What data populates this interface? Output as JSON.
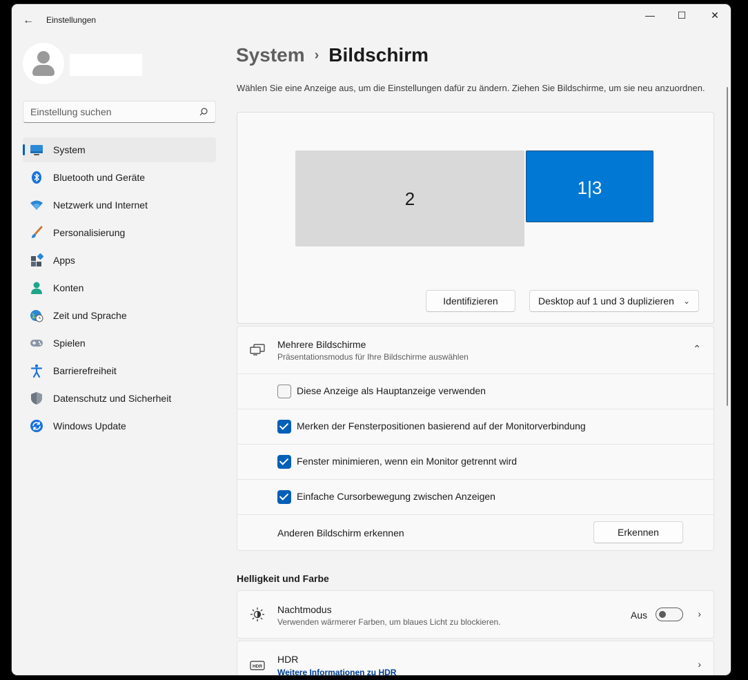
{
  "window": {
    "app_title": "Einstellungen",
    "controls": {
      "minimize": "—",
      "maximize": "☐",
      "close": "✕"
    }
  },
  "sidebar": {
    "search_placeholder": "Einstellung suchen",
    "items": [
      {
        "label": "System",
        "icon": "monitor-icon",
        "active": true
      },
      {
        "label": "Bluetooth und Geräte",
        "icon": "bluetooth-icon"
      },
      {
        "label": "Netzwerk und Internet",
        "icon": "wifi-icon"
      },
      {
        "label": "Personalisierung",
        "icon": "brush-icon"
      },
      {
        "label": "Apps",
        "icon": "apps-icon"
      },
      {
        "label": "Konten",
        "icon": "account-icon"
      },
      {
        "label": "Zeit und Sprache",
        "icon": "globe-clock-icon"
      },
      {
        "label": "Spielen",
        "icon": "gamepad-icon"
      },
      {
        "label": "Barrierefreiheit",
        "icon": "accessibility-icon"
      },
      {
        "label": "Datenschutz und Sicherheit",
        "icon": "shield-icon"
      },
      {
        "label": "Windows Update",
        "icon": "update-icon"
      }
    ]
  },
  "main": {
    "breadcrumb": {
      "parent": "System",
      "separator": "›",
      "current": "Bildschirm"
    },
    "description": "Wählen Sie eine Anzeige aus, um die Einstellungen dafür zu ändern. Ziehen Sie Bildschirme, um sie neu anzuordnen.",
    "arrangement": {
      "monitors": [
        {
          "label": "2",
          "selected": false
        },
        {
          "label": "1|3",
          "selected": true
        }
      ],
      "identify_button": "Identifizieren",
      "mode_select": "Desktop auf 1 und 3 duplizieren"
    },
    "multiple_displays": {
      "title": "Mehrere Bildschirme",
      "subtitle": "Präsentationsmodus für Ihre Bildschirme auswählen",
      "options": [
        {
          "label": "Diese Anzeige als Hauptanzeige verwenden",
          "checked": false
        },
        {
          "label": "Merken der Fensterpositionen basierend auf der Monitorverbindung",
          "checked": true
        },
        {
          "label": "Fenster minimieren, wenn ein Monitor getrennt wird",
          "checked": true
        },
        {
          "label": "Einfache Cursorbewegung zwischen Anzeigen",
          "checked": true
        }
      ],
      "detect_label": "Anderen Bildschirm erkennen",
      "detect_button": "Erkennen"
    },
    "brightness_section": {
      "heading": "Helligkeit und Farbe",
      "night_mode": {
        "title": "Nachtmodus",
        "subtitle": "Verwenden wärmerer Farben, um blaues Licht zu blockieren.",
        "state": "Aus"
      },
      "hdr": {
        "title": "HDR",
        "link": "Weitere Informationen zu HDR",
        "icon_text": "HDR"
      }
    }
  },
  "colors": {
    "accent": "#005fb8",
    "monitor_selected": "#0078d4",
    "monitor_unselected": "#d9d9d9"
  }
}
